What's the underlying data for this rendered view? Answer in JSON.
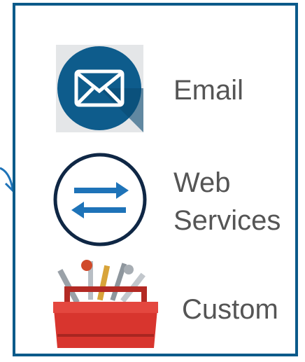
{
  "colors": {
    "border": "#0b5a8a",
    "email_bg": "#0e5c8c",
    "arrows": "#1e73b8",
    "ring": "#0f2745",
    "toolbox": "#d8352e",
    "label": "#555555"
  },
  "items": [
    {
      "label_lines": [
        "Email"
      ],
      "icon": "envelope-icon"
    },
    {
      "label_lines": [
        "Web",
        "Services"
      ],
      "icon": "exchange-arrows-icon"
    },
    {
      "label_lines": [
        "Custom"
      ],
      "icon": "toolbox-icon"
    }
  ]
}
